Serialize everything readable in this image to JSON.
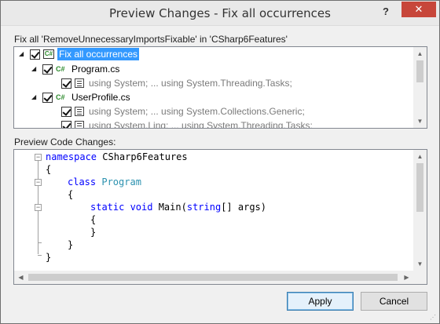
{
  "window": {
    "title": "Preview Changes - Fix all occurrences",
    "help_label": "?",
    "close_label": "✕"
  },
  "fix_label": "Fix all 'RemoveUnnecessaryImportsFixable' in 'CSharp6Features'",
  "tree": {
    "items": [
      {
        "label": "Fix all occurrences",
        "icon": "project-icon",
        "checked": true,
        "selected": true
      },
      {
        "label": "Program.cs",
        "icon": "csharp-file-icon",
        "checked": true
      },
      {
        "label": "using System; ... using System.Threading.Tasks;",
        "icon": "change-icon",
        "checked": true
      },
      {
        "label": "UserProfile.cs",
        "icon": "csharp-file-icon",
        "checked": true
      },
      {
        "label": "using System; ... using System.Collections.Generic;",
        "icon": "change-icon",
        "checked": true
      },
      {
        "label": "using System.Linq; ... using System.Threading.Tasks;",
        "icon": "change-icon",
        "checked": true
      }
    ]
  },
  "preview_label": "Preview Code Changes:",
  "code": {
    "lines": [
      {
        "kw": "namespace",
        "rest": " CSharp6Features"
      },
      {
        "text": "{"
      },
      {
        "kw": "class",
        "type": "Program"
      },
      {
        "text": "{"
      },
      {
        "kw": "static void",
        "rest": " Main(",
        "kw2": "string",
        "rest2": "[] args)"
      },
      {
        "text": "{"
      },
      {
        "text": "}"
      },
      {
        "text": "}"
      },
      {
        "text": "}"
      }
    ]
  },
  "buttons": {
    "apply": "Apply",
    "cancel": "Cancel"
  },
  "colors": {
    "keyword": "#0000ff",
    "type": "#2b91af",
    "selection": "#3399ff",
    "close_button": "#c7463a"
  }
}
